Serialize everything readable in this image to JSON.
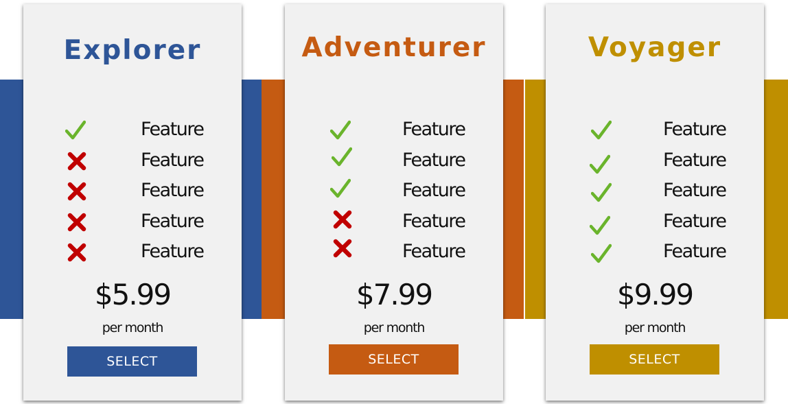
{
  "colors": {
    "explorer": "#2e5597",
    "adventurer": "#c55b12",
    "voyager": "#bf8f00",
    "check": "#6ab42c",
    "cross": "#c00000"
  },
  "plans": [
    {
      "name": "Explorer",
      "features": [
        {
          "label": "Feature",
          "icon": "check-icon"
        },
        {
          "label": "Feature",
          "icon": "cross-icon"
        },
        {
          "label": "Feature",
          "icon": "cross-icon"
        },
        {
          "label": "Feature",
          "icon": "cross-icon"
        },
        {
          "label": "Feature",
          "icon": "cross-icon"
        }
      ],
      "price": "$5.99",
      "period": "per month",
      "button_label": "SELECT"
    },
    {
      "name": "Adventurer",
      "features": [
        {
          "label": "Feature",
          "icon": "check-icon"
        },
        {
          "label": "Feature",
          "icon": "check-icon"
        },
        {
          "label": "Feature",
          "icon": "check-icon"
        },
        {
          "label": "Feature",
          "icon": "cross-icon"
        },
        {
          "label": "Feature",
          "icon": "cross-icon"
        }
      ],
      "price": "$7.99",
      "period": "per month",
      "button_label": "SELECT"
    },
    {
      "name": "Voyager",
      "features": [
        {
          "label": "Feature",
          "icon": "check-icon"
        },
        {
          "label": "Feature",
          "icon": "check-icon"
        },
        {
          "label": "Feature",
          "icon": "check-icon"
        },
        {
          "label": "Feature",
          "icon": "check-icon"
        },
        {
          "label": "Feature",
          "icon": "check-icon"
        }
      ],
      "price": "$9.99",
      "period": "per month",
      "button_label": "SELECT"
    }
  ]
}
